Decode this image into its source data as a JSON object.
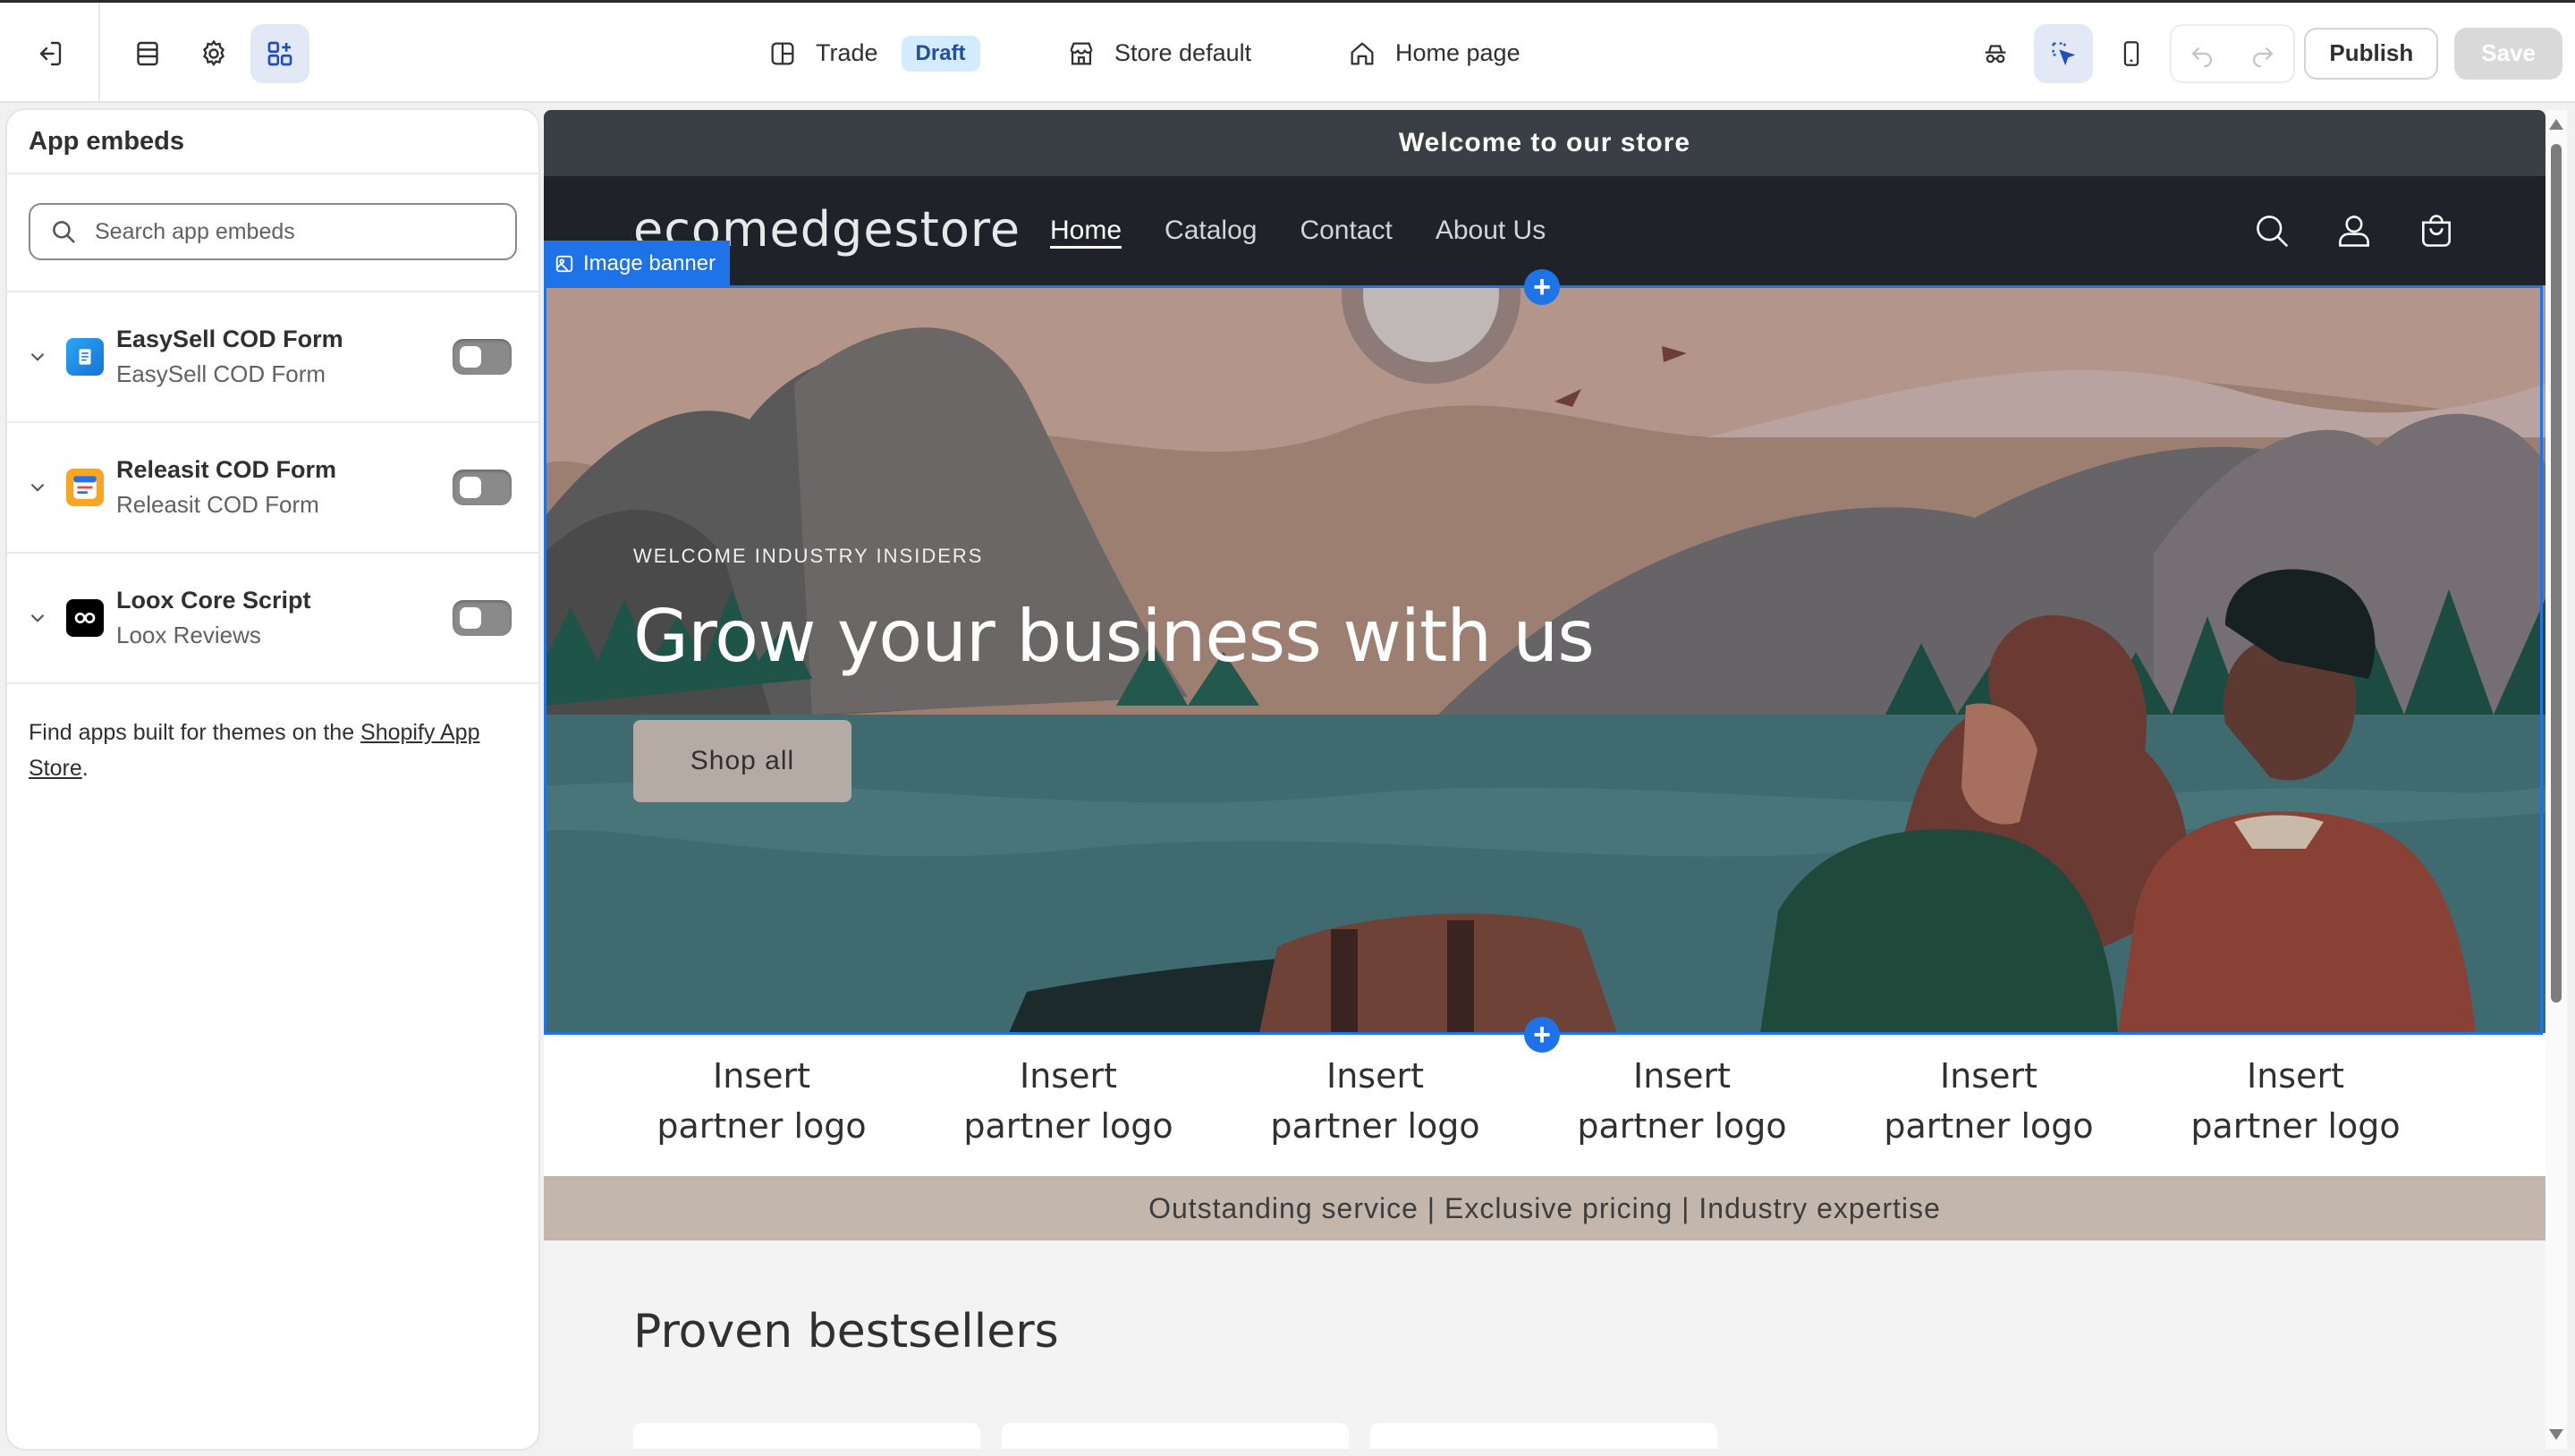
{
  "topbar": {
    "context": {
      "theme_name": "Trade",
      "theme_status": "Draft",
      "store_setting": "Store default",
      "page": "Home page"
    },
    "publish_label": "Publish",
    "save_label": "Save"
  },
  "sidebar": {
    "title": "App embeds",
    "search_placeholder": "Search app embeds",
    "embeds": [
      {
        "name": "EasySell COD Form",
        "app": "EasySell COD Form",
        "enabled": false,
        "icon": "easysell-icon"
      },
      {
        "name": "Releasit COD Form",
        "app": "Releasit COD Form",
        "enabled": false,
        "icon": "releasit-icon"
      },
      {
        "name": "Loox Core Script",
        "app": "Loox Reviews",
        "enabled": false,
        "icon": "loox-icon"
      }
    ],
    "footer_text": "Find apps built for themes on the ",
    "footer_link": "Shopify App Store",
    "footer_end": "."
  },
  "preview": {
    "announcement": "Welcome to our store",
    "logo": "ecomedgestore",
    "nav": [
      "Home",
      "Catalog",
      "Contact",
      "About Us"
    ],
    "selected_section": "Image banner",
    "hero": {
      "eyebrow": "WELCOME INDUSTRY INSIDERS",
      "headline": "Grow your business with us",
      "button": "Shop all"
    },
    "partner_logos": [
      [
        "Insert",
        "partner logo"
      ],
      [
        "Insert",
        "partner logo"
      ],
      [
        "Insert",
        "partner logo"
      ],
      [
        "Insert",
        "partner logo"
      ],
      [
        "Insert",
        "partner logo"
      ],
      [
        "Insert",
        "partner logo"
      ]
    ],
    "tagline": "Outstanding service | Exclusive pricing | Industry expertise",
    "section_heading": "Proven bestsellers"
  },
  "colors": {
    "accent": "#1f73e8",
    "header_bg": "#1f2329",
    "announcement_bg": "#3a3e45",
    "tagline_bg": "#c2b6ad",
    "badge_bg": "#d5ebff"
  }
}
